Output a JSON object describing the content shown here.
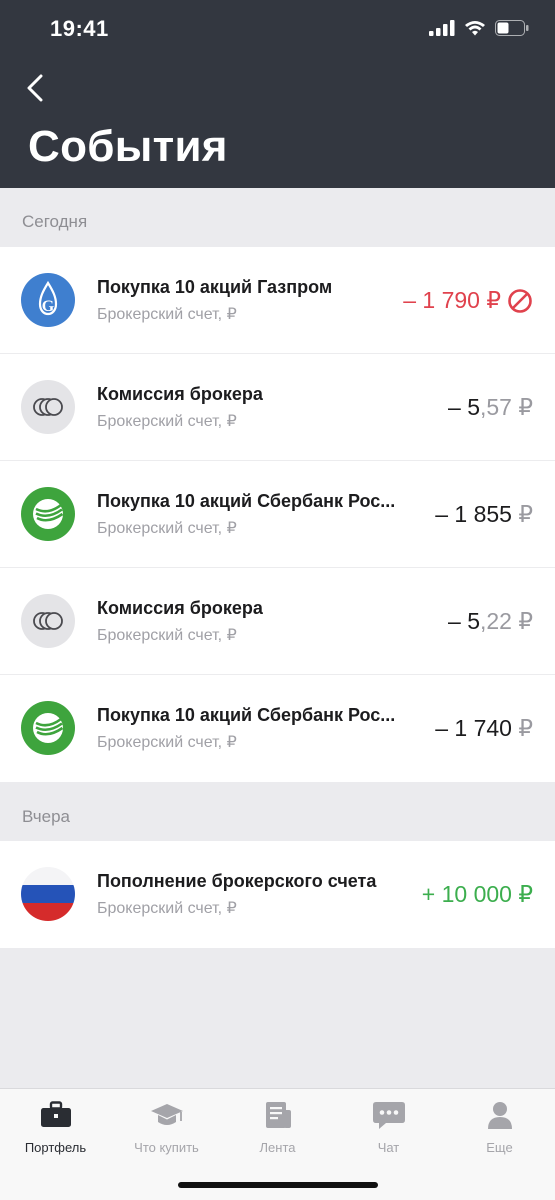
{
  "status_bar": {
    "time": "19:41"
  },
  "header": {
    "title": "События"
  },
  "sections": [
    {
      "label": "Сегодня",
      "items": [
        {
          "title": "Покупка 10 акций Газпром",
          "subtitle": "Брокерский счет, ₽",
          "sign": "– ",
          "int": "1 790",
          "frac": "",
          "currency": " ₽",
          "icon": "gazprom-logo-icon",
          "amount_color": "#e0424d",
          "status_icon": "cancelled-icon"
        },
        {
          "title": "Комиссия брокера",
          "subtitle": "Брокерский счет, ₽",
          "sign": "– ",
          "int": "5",
          "frac": ",57",
          "currency": " ₽",
          "icon": "coins-icon",
          "amount_color": "#1c1c1e"
        },
        {
          "title": "Покупка 10 акций Сбербанк Рос...",
          "subtitle": "Брокерский счет, ₽",
          "sign": "– ",
          "int": "1 855",
          "frac": "",
          "currency": " ₽",
          "icon": "sberbank-logo-icon",
          "amount_color": "#1c1c1e"
        },
        {
          "title": "Комиссия брокера",
          "subtitle": "Брокерский счет, ₽",
          "sign": "– ",
          "int": "5",
          "frac": ",22",
          "currency": " ₽",
          "icon": "coins-icon",
          "amount_color": "#1c1c1e"
        },
        {
          "title": "Покупка 10 акций Сбербанк Рос...",
          "subtitle": "Брокерский счет, ₽",
          "sign": "– ",
          "int": "1 740",
          "frac": "",
          "currency": " ₽",
          "icon": "sberbank-logo-icon",
          "amount_color": "#1c1c1e"
        }
      ]
    },
    {
      "label": "Вчера",
      "items": [
        {
          "title": "Пополнение брокерского счета",
          "subtitle": "Брокерский счет, ₽",
          "sign": "+ ",
          "int": "10 000",
          "frac": "",
          "currency": " ₽",
          "icon": "russia-flag-icon",
          "amount_color": "#3cae4e"
        }
      ]
    }
  ],
  "tabbar": {
    "items": [
      {
        "label": "Портфель",
        "icon": "briefcase-icon",
        "active": true
      },
      {
        "label": "Что купить",
        "icon": "graduation-cap-icon",
        "active": false
      },
      {
        "label": "Лента",
        "icon": "news-feed-icon",
        "active": false
      },
      {
        "label": "Чат",
        "icon": "chat-icon",
        "active": false
      },
      {
        "label": "Еще",
        "icon": "profile-icon",
        "active": false
      }
    ]
  },
  "colors": {
    "header_bg": "#333740",
    "negative": "#e0424d",
    "positive": "#3cae4e",
    "tab_active": "#2a2d33",
    "tab_inactive": "#a5a5aa"
  }
}
